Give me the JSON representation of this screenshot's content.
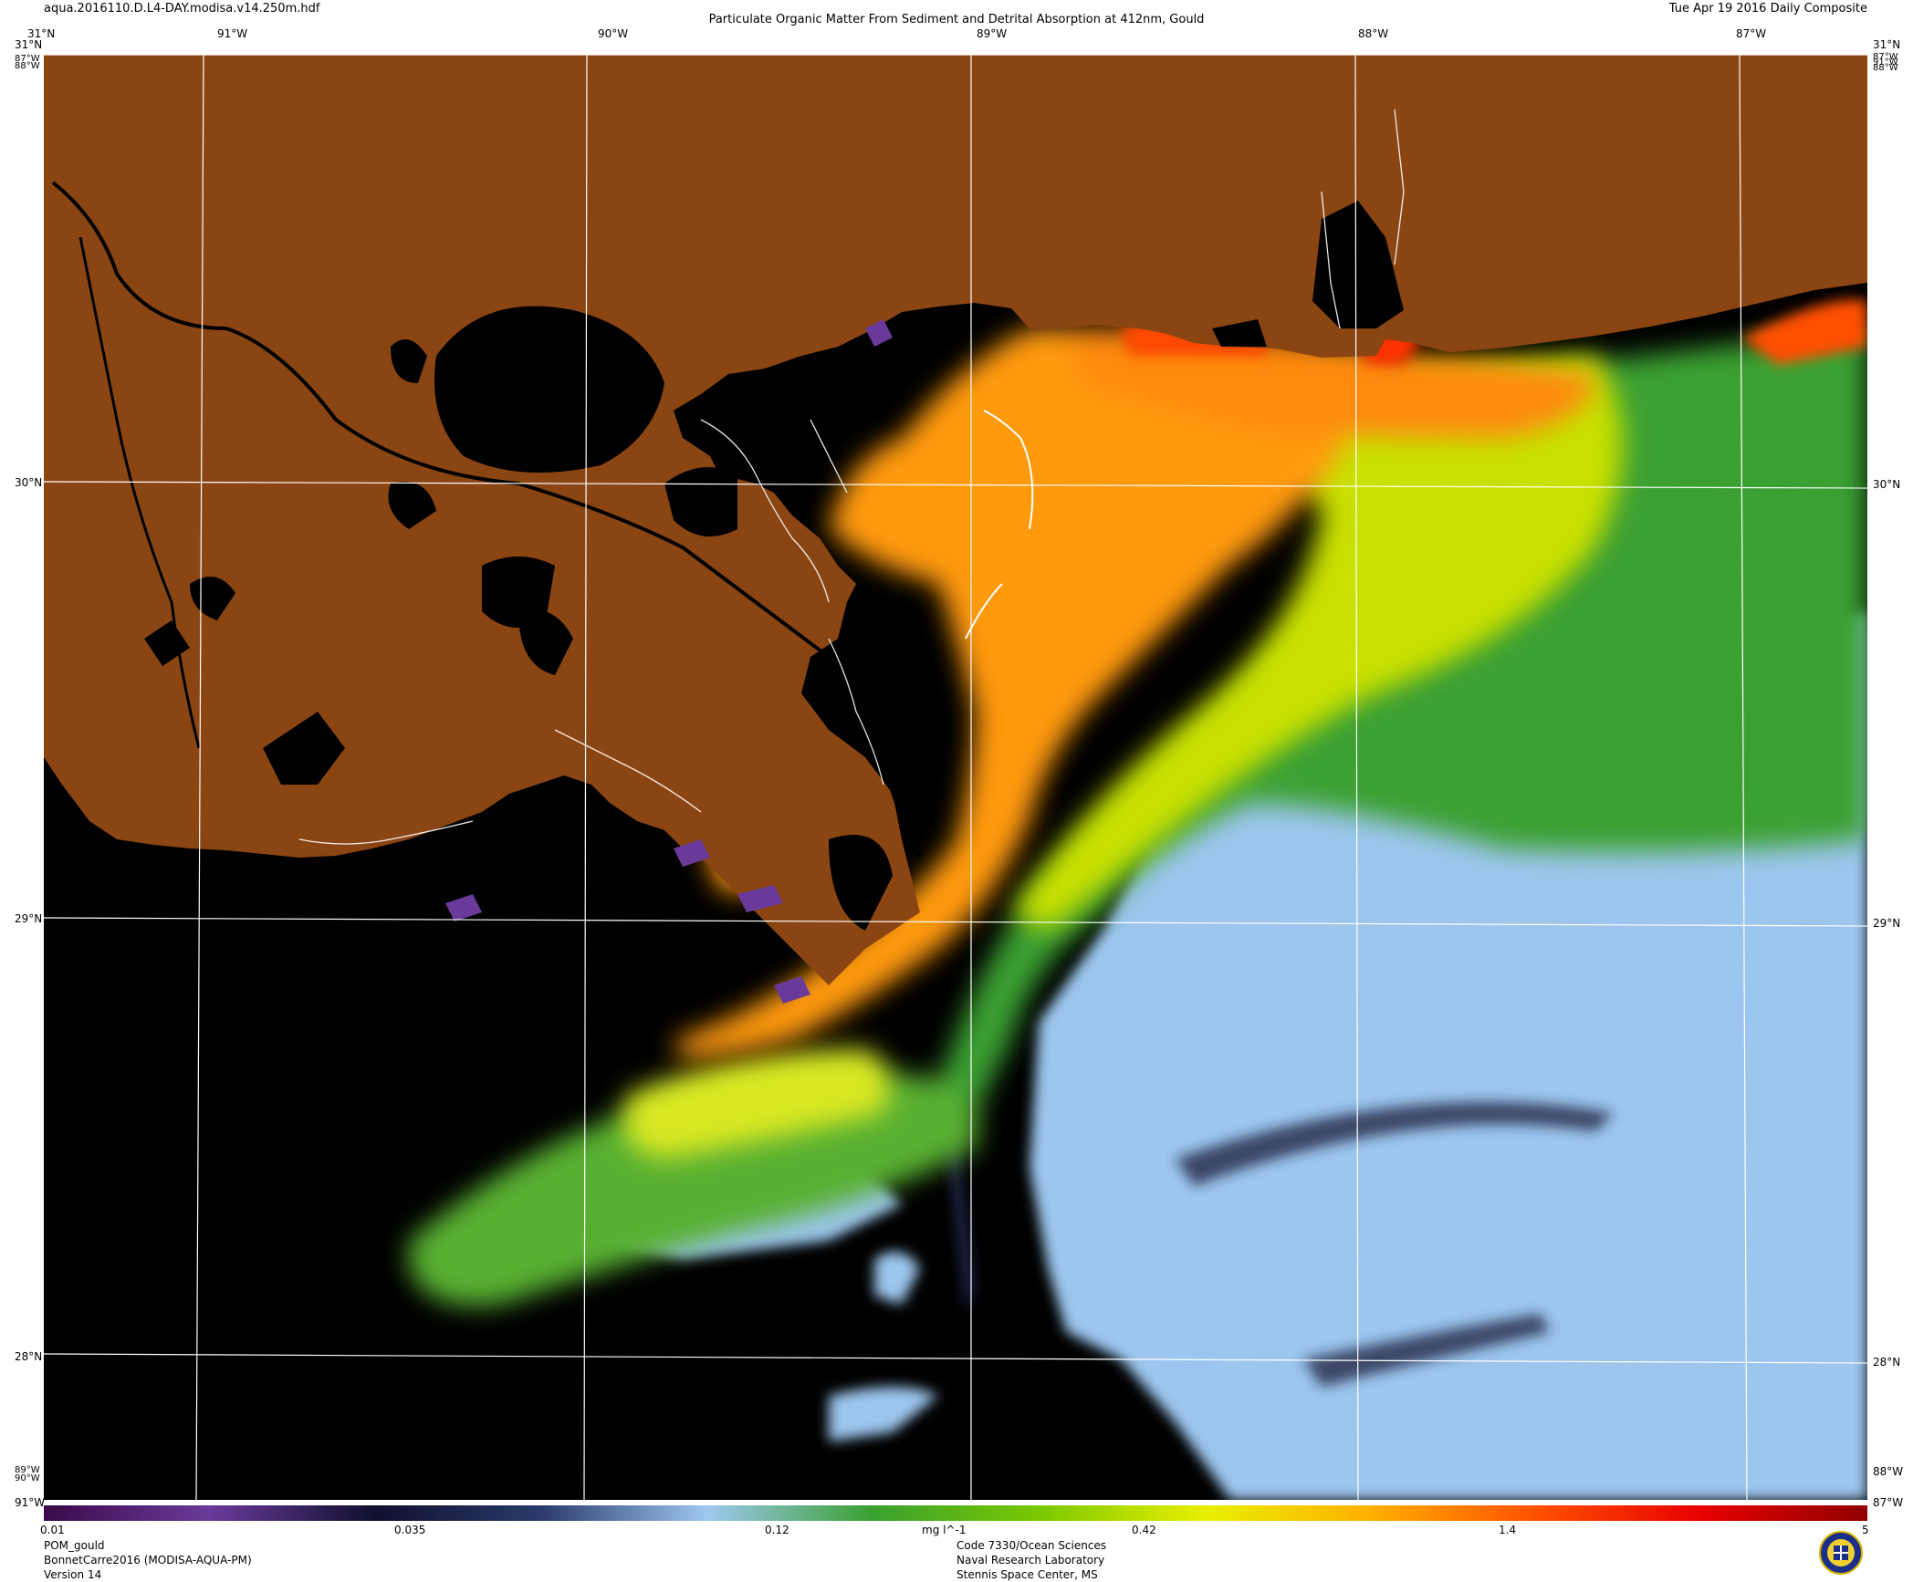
{
  "header": {
    "filename": "aqua.2016110.D.L4-DAY.modisa.v14.250m.hdf",
    "title": "Particulate Organic Matter From Sediment and Detrital Absorption at 412nm, Gould",
    "date": "Tue Apr 19 2016 Daily Composite"
  },
  "top_lon_labels": [
    "31°N",
    "91°W",
    "90°W",
    "89°W",
    "88°W",
    "87°W"
  ],
  "left_lat_labels": [
    "31°N",
    "87°W",
    "88°W",
    "30°N",
    "29°N",
    "28°N",
    "89°W",
    "90°W",
    "91°W"
  ],
  "right_lat_labels": [
    "31°N",
    "87°W",
    "91°W",
    "88°W",
    "30°N",
    "29°N",
    "28°N",
    "88°W",
    "87°W"
  ],
  "colorbar": {
    "ticks": [
      "0.01",
      "0.035",
      "0.12",
      "0.42",
      "1.4",
      "5"
    ],
    "unit": "mg l^-1",
    "stops": [
      "#3a0a4a",
      "#6a3a9a",
      "#101030",
      "#2a3a6a",
      "#9ec8f0",
      "#3aa030",
      "#7ac800",
      "#e8f000",
      "#ffb000",
      "#ff5000",
      "#e80000",
      "#900000"
    ]
  },
  "footer_left": [
    "POM_gould",
    "BonnetCarre2016 (MODISA-AQUA-PM)",
    "Version 14"
  ],
  "footer_center": [
    "Code 7330/Ocean Sciences",
    "Naval Research Laboratory",
    "Stennis Space Center, MS"
  ],
  "colors": {
    "land": "#8b4513",
    "nodata": "#000000",
    "gridline": "#ffffff"
  },
  "icons": {
    "logo": "nrl-seal-icon"
  }
}
